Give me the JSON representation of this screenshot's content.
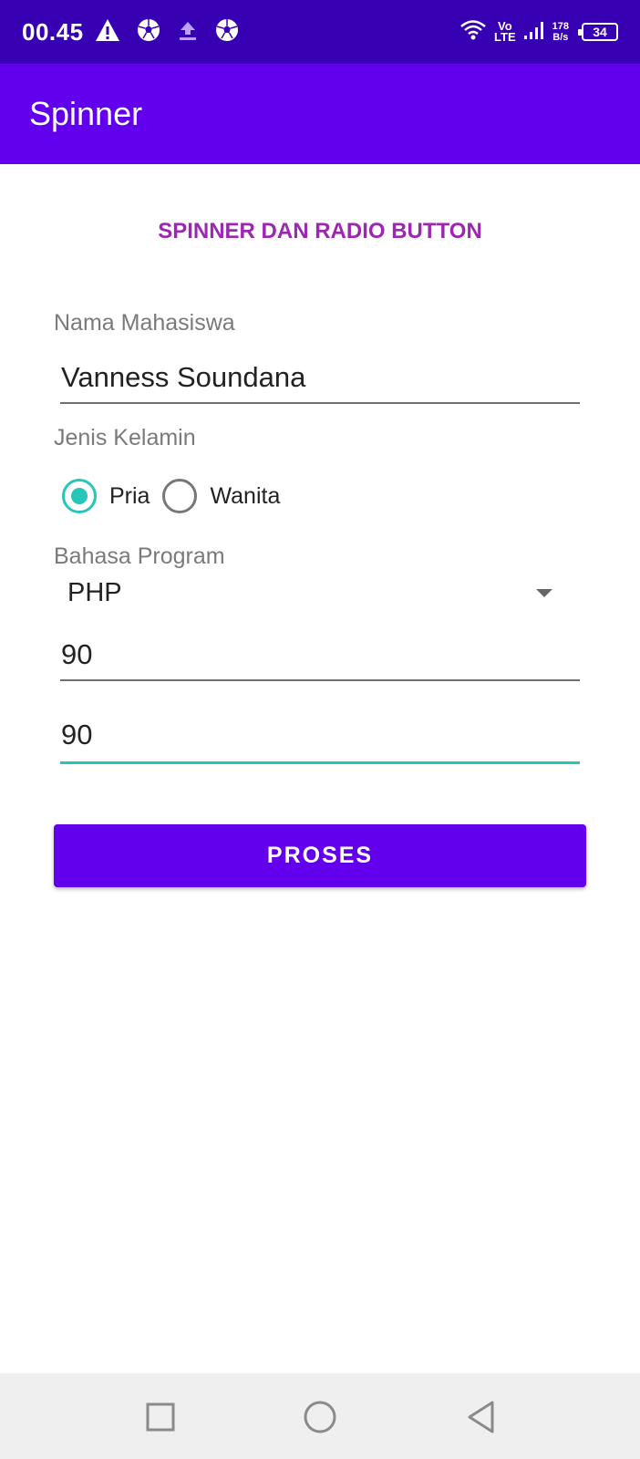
{
  "status_bar": {
    "time": "00.45",
    "left_icons": [
      "warning-icon",
      "football-icon",
      "upload-icon",
      "football-icon"
    ],
    "network": {
      "vo": "Vo",
      "lte": "LTE"
    },
    "speed": {
      "value": "178",
      "unit": "B/s"
    },
    "battery": "34"
  },
  "app_bar": {
    "title": "Spinner"
  },
  "form": {
    "heading": "SPINNER DAN RADIO BUTTON",
    "nama_label": "Nama Mahasiswa",
    "nama_value": "Vanness Soundana",
    "jenis_label": "Jenis Kelamin",
    "radios": [
      {
        "label": "Pria",
        "checked": true
      },
      {
        "label": "Wanita",
        "checked": false
      }
    ],
    "bahasa_label": "Bahasa Program",
    "bahasa_value": "PHP",
    "value_1": "90",
    "value_2": "90",
    "button_label": "PROSES"
  },
  "colors": {
    "status_bar": "#3700b3",
    "primary": "#6200ee",
    "heading": "#9c27b0",
    "accent": "#26c6b8"
  },
  "nav_bar": {
    "icons": [
      "recent-apps-icon",
      "home-icon",
      "back-icon"
    ]
  }
}
